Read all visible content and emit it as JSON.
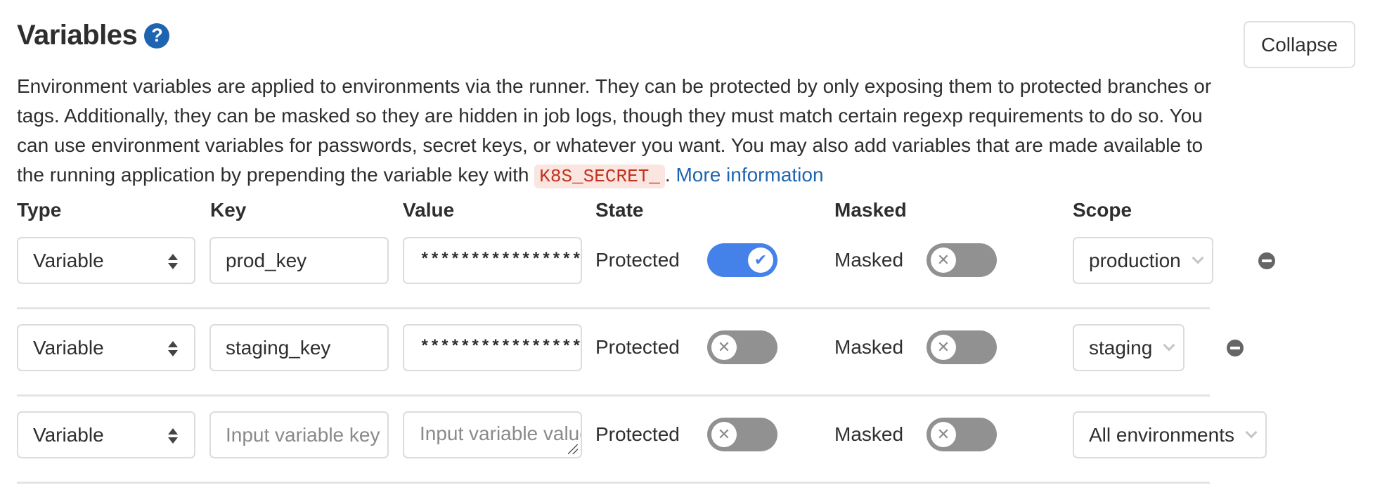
{
  "header": {
    "title": "Variables",
    "help_icon": "question-circle-icon",
    "collapse_label": "Collapse"
  },
  "description": {
    "text": "Environment variables are applied to environments via the runner. They can be protected by only exposing them to protected branches or tags. Additionally, they can be masked so they are hidden in job logs, though they must match certain regexp requirements to do so. You can use environment variables for passwords, secret keys, or whatever you want. You may also add variables that are made available to the running application by prepending the variable key with ",
    "code": "K8S_SECRET_",
    "after_code": ". ",
    "link_label": "More information"
  },
  "columns": {
    "type": "Type",
    "key": "Key",
    "value": "Value",
    "state": "State",
    "masked": "Masked",
    "scope": "Scope"
  },
  "rows": [
    {
      "type": "Variable",
      "key": "prod_key",
      "key_placeholder": "",
      "value": "*****************",
      "value_placeholder": "",
      "protected_label": "Protected",
      "protected": true,
      "masked_label": "Masked",
      "masked": false,
      "scope": "production",
      "removable": true
    },
    {
      "type": "Variable",
      "key": "staging_key",
      "key_placeholder": "",
      "value": "*****************",
      "value_placeholder": "",
      "protected_label": "Protected",
      "protected": false,
      "masked_label": "Masked",
      "masked": false,
      "scope": "staging",
      "removable": true
    },
    {
      "type": "Variable",
      "key": "",
      "key_placeholder": "Input variable key",
      "value": "",
      "value_placeholder": "Input variable value",
      "protected_label": "Protected",
      "protected": false,
      "masked_label": "Masked",
      "masked": false,
      "scope": "All environments",
      "removable": false
    }
  ],
  "icons": {
    "toggle_on": "✔",
    "toggle_off": "✕"
  },
  "colors": {
    "accent": "#4481e8",
    "link": "#1f64b0",
    "toggle_off": "#919191",
    "code_text": "#c0341d",
    "code_bg": "#fbe5e1"
  }
}
